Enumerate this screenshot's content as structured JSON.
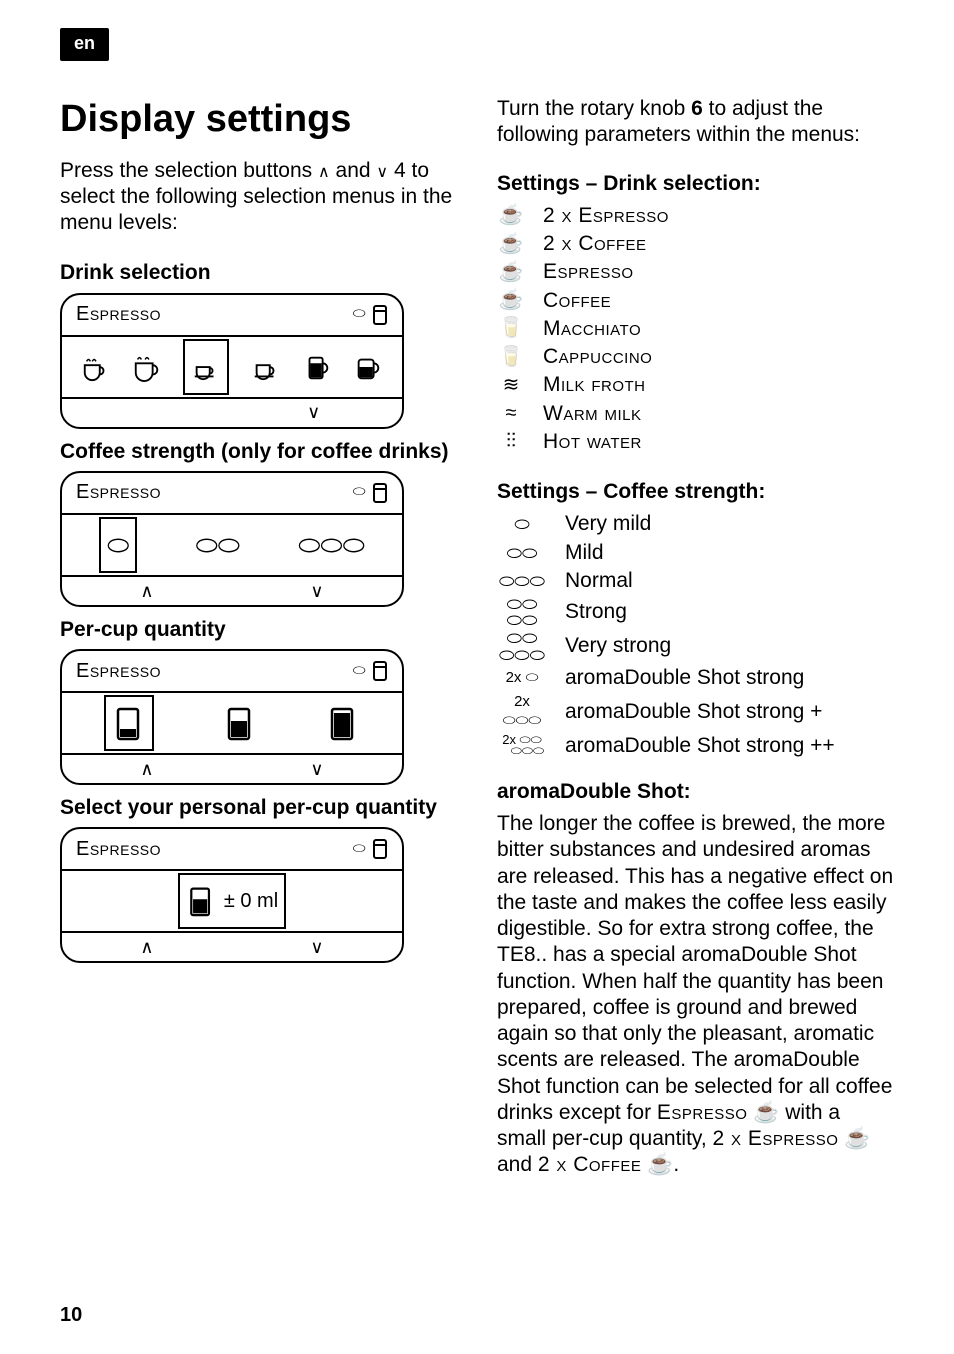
{
  "lang": "en",
  "page_number": "10",
  "left": {
    "title": "Display settings",
    "intro_parts": {
      "a": "Press the selection buttons ",
      "b": " and ",
      "c": " 4 to select the following selection menus in the menu levels:"
    },
    "up_glyph": "∧",
    "down_glyph": "∨",
    "sections": {
      "drink": "Drink selection",
      "strength": "Coffee strength (only for coffee drinks)",
      "percup": "Per-cup quantity",
      "personal": "Select your personal per-cup quantity"
    },
    "display_title": "Espresso",
    "ml_label": "± 0 ml",
    "topright_bean": "⬭",
    "topright_cup": "🥛"
  },
  "right": {
    "intro": "Turn the rotary knob 6 to adjust the following parameters within the menus:",
    "settings_drink_header": "Settings – Drink selection:",
    "drinks": [
      "2 x Espresso",
      "2 x Coffee",
      "Espresso",
      "Coffee",
      "Macchiato",
      "Cappuccino",
      "Milk froth",
      "Warm milk",
      "Hot water"
    ],
    "settings_strength_header": "Settings – Coffee strength:",
    "strengths": [
      "Very mild",
      "Mild",
      "Normal",
      "Strong",
      "Very strong",
      "aromaDouble Shot strong",
      "aromaDouble Shot strong +",
      "aromaDouble Shot strong ++"
    ],
    "aroma_header": "aromaDouble Shot:",
    "aroma_body_parts": {
      "a": "The longer the coffee is brewed, the more bitter substances and undesired aromas are released. This has a negative effect on the taste and makes the coffee less easily digestible. So for extra strong coffee, the TE8.. has a special aromaDouble Shot function. When half the quantity has been prepared, coffee is ground and brewed again so that only the pleasant, aromatic scents are released. The aromaDouble Shot function can be selected for all coffee drinks except for ",
      "b": "Espresso",
      "c": " ☕ with a small per-cup quantity, ",
      "d": "2 x Espresso",
      "e": " ☕ and ",
      "f": "2 x Coffee",
      "g": " ☕."
    }
  }
}
